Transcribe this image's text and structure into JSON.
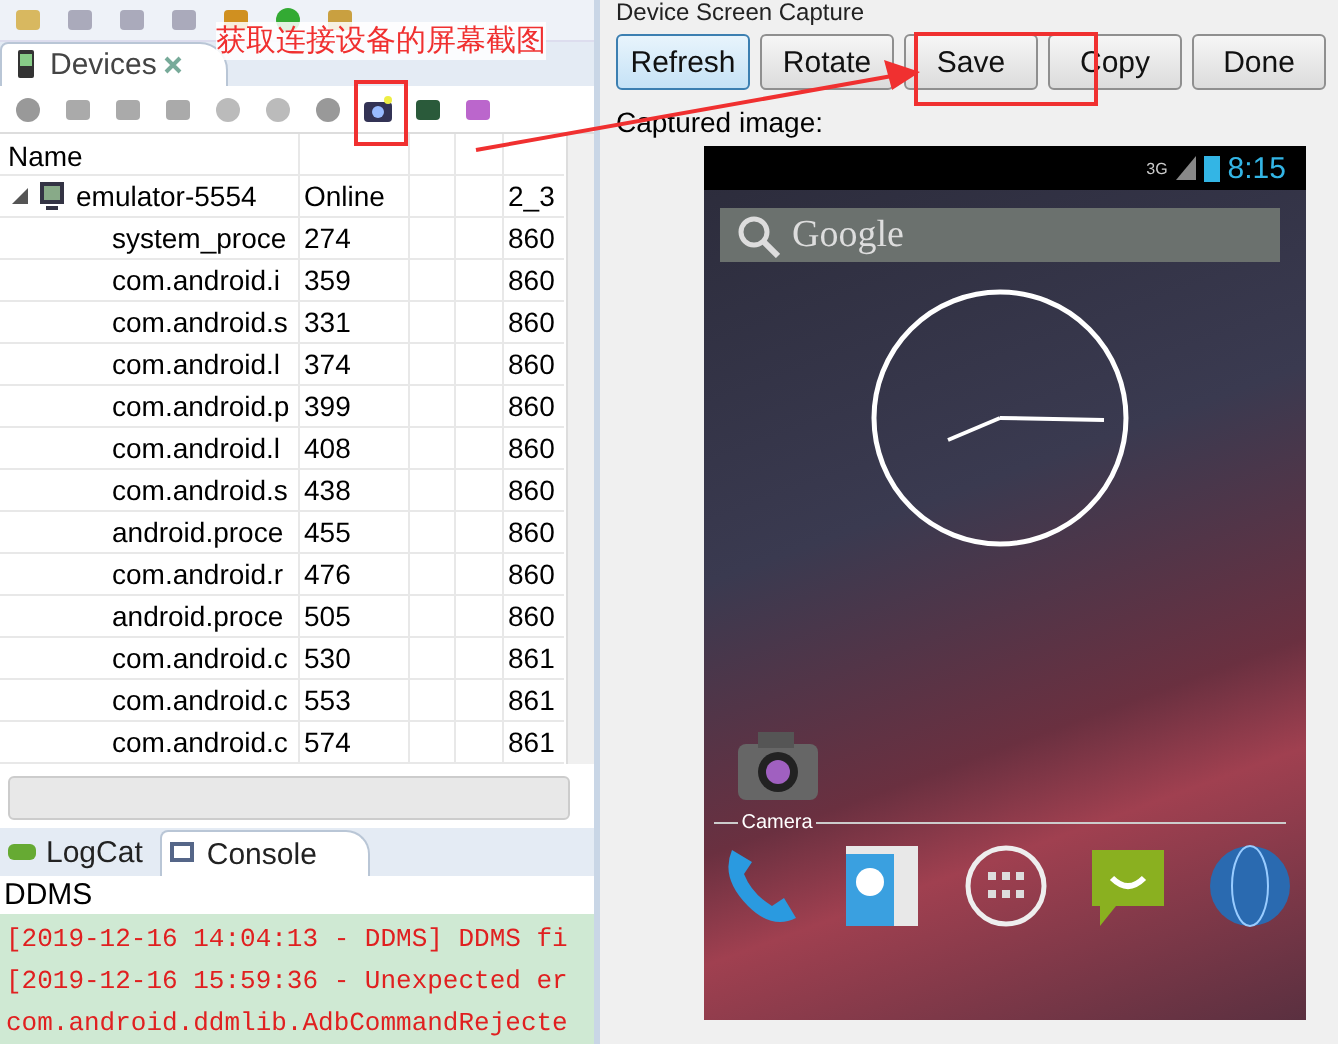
{
  "annotation": {
    "text": "获取连接设备的屏幕截图"
  },
  "devices_view": {
    "tab": "Devices",
    "columns": [
      "Name"
    ],
    "device": {
      "name": "emulator-5554",
      "status": "Online",
      "column_5": "2_3",
      "expanded": true,
      "children": [
        {
          "name": "system_proce",
          "pid": "274",
          "column_5": "860"
        },
        {
          "name": "com.android.i",
          "pid": "359",
          "column_5": "860"
        },
        {
          "name": "com.android.s",
          "pid": "331",
          "column_5": "860"
        },
        {
          "name": "com.android.l",
          "pid": "374",
          "column_5": "860"
        },
        {
          "name": "com.android.p",
          "pid": "399",
          "column_5": "860"
        },
        {
          "name": "com.android.l",
          "pid": "408",
          "column_5": "860"
        },
        {
          "name": "com.android.s",
          "pid": "438",
          "column_5": "860"
        },
        {
          "name": "android.proce",
          "pid": "455",
          "column_5": "860"
        },
        {
          "name": "com.android.r",
          "pid": "476",
          "column_5": "860"
        },
        {
          "name": "android.proce",
          "pid": "505",
          "column_5": "860"
        },
        {
          "name": "com.android.c",
          "pid": "530",
          "column_5": "861"
        },
        {
          "name": "com.android.c",
          "pid": "553",
          "column_5": "861"
        },
        {
          "name": "com.android.c",
          "pid": "574",
          "column_5": "861"
        }
      ]
    }
  },
  "bottom_tabs": [
    {
      "label": "LogCat",
      "selected": false
    },
    {
      "label": "Console",
      "selected": true
    }
  ],
  "console": {
    "name": "DDMS",
    "lines": [
      "[2019-12-16 14:04:13 - DDMS] DDMS fi",
      "[2019-12-16 15:59:36 - Unexpected er",
      "com.android.ddmlib.AdbCommandRejecte"
    ]
  },
  "capture_dialog": {
    "title": "Device Screen Capture",
    "buttons": [
      {
        "label": "Refresh",
        "selected": true
      },
      {
        "label": "Rotate",
        "selected": false
      },
      {
        "label": "Save",
        "selected": false
      },
      {
        "label": "Copy",
        "selected": false
      },
      {
        "label": "Done",
        "selected": false
      }
    ],
    "image_label": "Captured image:",
    "phone": {
      "network": "3G",
      "time": "8:15",
      "search": "Google",
      "shortcut": "Camera"
    }
  }
}
